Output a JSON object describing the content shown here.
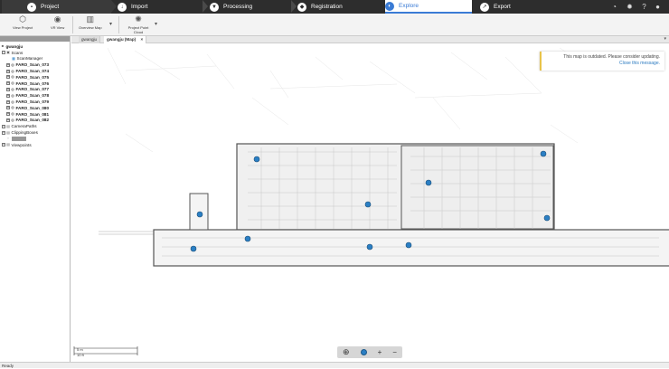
{
  "topbar": {
    "tabs": [
      {
        "label": "Project",
        "icon": "folder-icon"
      },
      {
        "label": "Import",
        "icon": "import-icon"
      },
      {
        "label": "Processing",
        "icon": "processing-icon"
      },
      {
        "label": "Registration",
        "icon": "registration-icon"
      },
      {
        "label": "Explore",
        "icon": "explore-icon",
        "active": true
      },
      {
        "label": "Export",
        "icon": "export-icon"
      }
    ],
    "right_icons": [
      "puzzle-icon",
      "settings-icon",
      "help-icon",
      "user-icon"
    ]
  },
  "ribbon": {
    "buttons": [
      {
        "label": "View Project",
        "icon": "cube-icon"
      },
      {
        "label": "VR View",
        "icon": "vr-headset-icon"
      },
      {
        "label": "Overview Map",
        "icon": "map-icon"
      },
      {
        "label": "Project Point Cloud",
        "icon": "point-cloud-icon"
      }
    ]
  },
  "tree": {
    "root": "gwangju",
    "scans_label": "Scans",
    "scan_manager": "ScanManager",
    "scans": [
      "FARO_Scan_073",
      "FARO_Scan_074",
      "FARO_Scan_075",
      "FARO_Scan_076",
      "FARO_Scan_077",
      "FARO_Scan_078",
      "FARO_Scan_079",
      "FARO_Scan_080",
      "FARO_Scan_081",
      "FARO_Scan_082"
    ],
    "camera_paths": "CameraPaths",
    "clipping_boxes": "ClippingBoxes",
    "viewpoints": "Viewpoints"
  },
  "viewtabs": [
    {
      "label": "gwangju"
    },
    {
      "label": "gwangju (Map)",
      "active": true,
      "close": "×"
    }
  ],
  "notice": {
    "message": "This map is outdated. Please consider updating.",
    "link": "Close this message."
  },
  "scale": {
    "meters": "5 m",
    "feet": "10 ft"
  },
  "zoom": {
    "zoom_icon": "zoom-icon",
    "plus": "+",
    "minus": "−"
  },
  "status": "Ready",
  "colors": {
    "accent": "#3a7bd5",
    "scan_marker": "#2b7fc4",
    "topbar": "#2d2d2d"
  }
}
